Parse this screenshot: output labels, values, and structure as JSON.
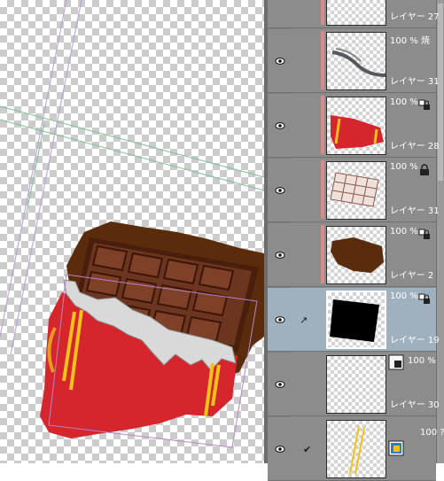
{
  "canvas": {
    "subject": "chocolate-bar-illustration",
    "colors": {
      "wrapper": "#d4262c",
      "chocolate_dark": "#4a1e0c",
      "chocolate": "#6b3520",
      "foil": "#d9d9d9",
      "stripe": "#f2c21a",
      "smudge": "#5a2c0c",
      "guide_purple": "#b79cd8",
      "guide_green": "#7dbf8e"
    }
  },
  "layers_panel": {
    "rows": [
      {
        "opacity": "",
        "name": "レイヤー 27",
        "visible": true,
        "clipped": true,
        "thumb": "scribble"
      },
      {
        "opacity": "100 % 焼",
        "name": "レイヤー 31",
        "visible": true,
        "clipped": true,
        "thumb": "gray-stroke"
      },
      {
        "opacity": "100 %",
        "name": "レイヤー 28",
        "visible": true,
        "clipped": true,
        "thumb": "red-wrapper",
        "icon": "lock-alpha-icon"
      },
      {
        "opacity": "100 %",
        "name": "レイヤー 31",
        "visible": true,
        "clipped": true,
        "thumb": "chocolate-grid",
        "icon": "lock-icon"
      },
      {
        "opacity": "100 %",
        "name": "レイヤー 2",
        "visible": true,
        "clipped": true,
        "thumb": "brown-blob",
        "icon": "lock-alpha-icon"
      },
      {
        "opacity": "100 % :",
        "name": "レイヤー 19",
        "visible": true,
        "clipped": false,
        "selected": true,
        "link": "↗",
        "thumb": "black-shape",
        "icon": "lock-alpha-icon"
      },
      {
        "opacity": "100 %",
        "name": "レイヤー 30",
        "visible": true,
        "clipped": false,
        "thumb": "empty",
        "icon": "layer-mode-icon"
      },
      {
        "opacity": "100 ?",
        "name": "",
        "visible": true,
        "clipped": false,
        "check": "✔",
        "thumb": "yellow-lines",
        "icon": "folder-color-icon"
      }
    ]
  }
}
